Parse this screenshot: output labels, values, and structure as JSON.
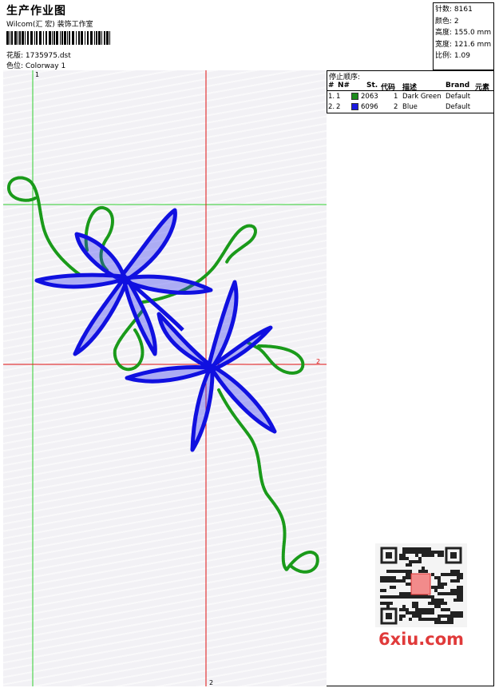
{
  "header": {
    "title": "生产作业图",
    "company": "Wilcom(汇 宏) 装饰工作室",
    "design_line": "花版:  1735975.dst",
    "colorway_line": "色位:  Colorway 1"
  },
  "specs": [
    {
      "label": "针数",
      "value": "8161"
    },
    {
      "label": "颜色",
      "value": "2"
    },
    {
      "label": "高度",
      "value": "155.0 mm"
    },
    {
      "label": "宽度",
      "value": "121.6 mm"
    },
    {
      "label": "比例",
      "value": "1.09"
    }
  ],
  "stop_sequence": {
    "title": "停止顺序:",
    "headers": [
      "#",
      "N#",
      "St.",
      "代码",
      "描述",
      "Brand",
      "元素"
    ],
    "rows": [
      {
        "idx": "1.",
        "n": "1",
        "stitches": "2063",
        "code": "1",
        "desc": "Dark Green",
        "brand": "Default",
        "color": "#1a8a1a"
      },
      {
        "idx": "2.",
        "n": "2",
        "stitches": "6096",
        "code": "2",
        "desc": "Blue",
        "brand": "Default",
        "color": "#1a1ae0"
      }
    ]
  },
  "guides": {
    "v1_label": "1",
    "h2_label": "2",
    "v2_label": "2"
  },
  "colors": {
    "thread_green": "#1a9a1a",
    "thread_blue": "#1010e0",
    "guide_red": "#e01010",
    "guide_green": "#30d030"
  },
  "watermark": {
    "text": "6xiu.com"
  }
}
